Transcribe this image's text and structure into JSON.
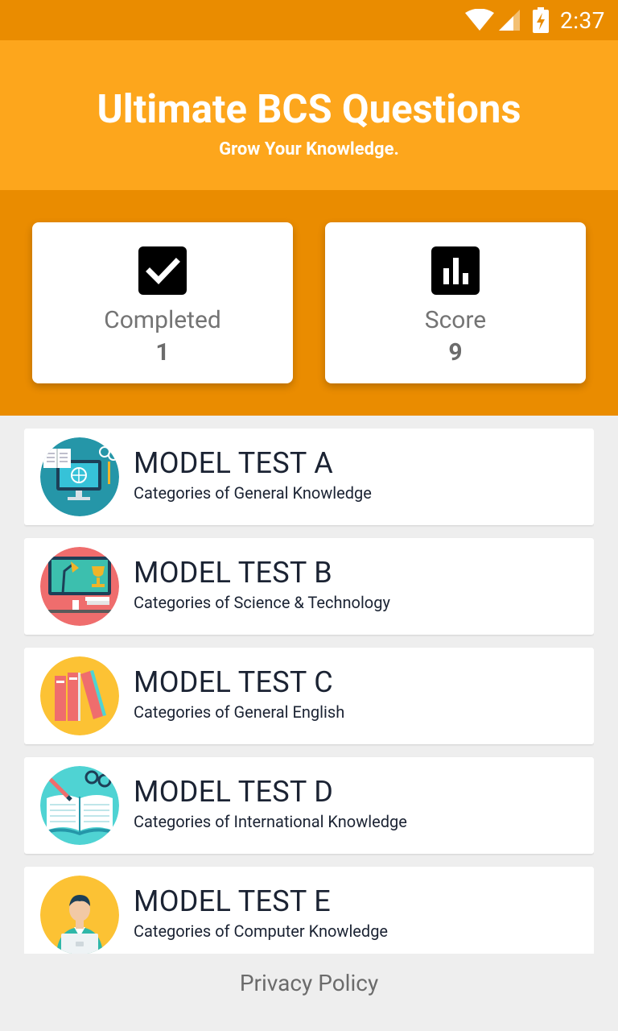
{
  "status_bar": {
    "time": "2:37",
    "icons": [
      "wifi-icon",
      "signal-icon",
      "battery-charging-icon"
    ]
  },
  "header": {
    "title": "Ultimate BCS Questions",
    "subtitle": "Grow Your Knowledge."
  },
  "stats": {
    "completed": {
      "label": "Completed",
      "value": "1",
      "icon": "checkbox-icon"
    },
    "score": {
      "label": "Score",
      "value": "9",
      "icon": "bar-chart-icon"
    }
  },
  "tests": [
    {
      "name": "MODEL TEST A",
      "desc": "Categories of General Knowledge",
      "icon": "computer-globe-icon",
      "bg": "#2596a8"
    },
    {
      "name": "MODEL TEST B",
      "desc": "Categories of Science & Technology",
      "icon": "desk-lamp-trophy-icon",
      "bg": "#ef6d6d"
    },
    {
      "name": "MODEL TEST C",
      "desc": "Categories of General English",
      "icon": "books-icon",
      "bg": "#fcc234"
    },
    {
      "name": "MODEL TEST D",
      "desc": "Categories of International Knowledge",
      "icon": "open-book-icon",
      "bg": "#4fd3d3"
    },
    {
      "name": "MODEL TEST E",
      "desc": "Categories of Computer Knowledge",
      "icon": "person-laptop-icon",
      "bg": "#fcc234"
    }
  ],
  "footer": {
    "privacy_label": "Privacy Policy"
  },
  "colors": {
    "status_bar": "#ea8c00",
    "header": "#fda61c",
    "stats_bg": "#ea8c00",
    "list_bg": "#eeeeee"
  }
}
